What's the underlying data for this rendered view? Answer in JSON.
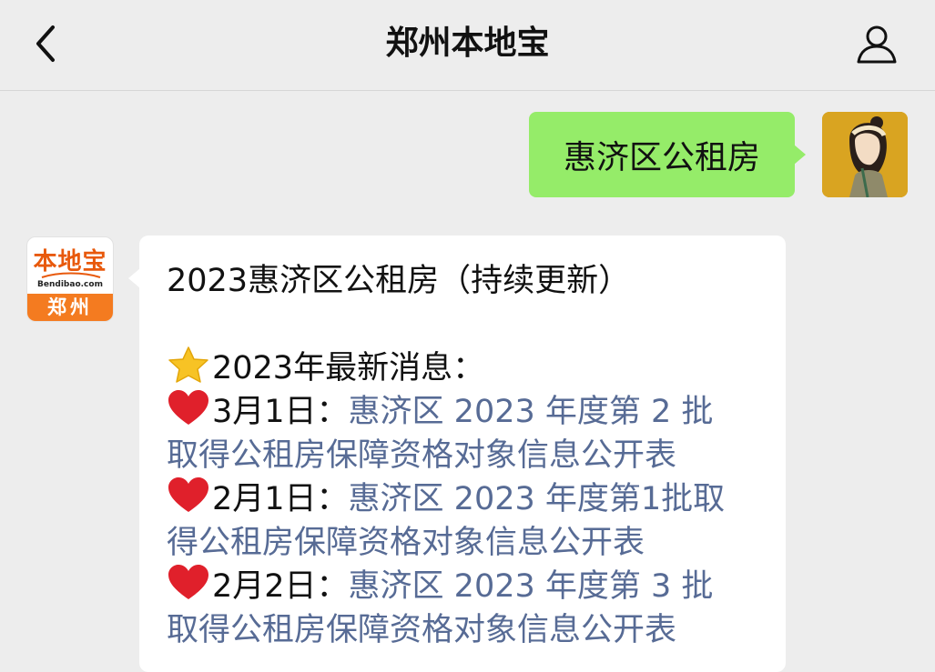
{
  "header": {
    "title": "郑州本地宝"
  },
  "messages": {
    "outgoing": {
      "text": "惠济区公租房"
    },
    "incoming": {
      "title": "2023惠济区公租房（持续更新）",
      "section_heading": "2023年最新消息：",
      "items": [
        {
          "date": "3月1日：",
          "link_line1": "惠济区 2023 年度第 2 批",
          "link_line2": "取得公租房保障资格对象信息公开表"
        },
        {
          "date": "2月1日：",
          "link_line1": "惠济区 2023 年度第1批取",
          "link_line2": "得公租房保障资格对象信息公开表"
        },
        {
          "date": "2月2日：",
          "link_line1": "惠济区 2023 年度第 3 批",
          "link_line2": "取得公租房保障资格对象信息公开表"
        }
      ]
    }
  },
  "bot_avatar": {
    "logo_text": "本地宝",
    "logo_sub": "Bendibao.com",
    "city": "郑州"
  },
  "colors": {
    "background": "#ededed",
    "outgoing_bubble": "#95ec69",
    "incoming_bubble": "#ffffff",
    "link": "#576b95",
    "brand_orange": "#f47b20"
  },
  "icons": {
    "back": "chevron-left-icon",
    "profile": "person-icon",
    "section": "star-emoji",
    "item_bullet": "red-heart-emoji"
  }
}
